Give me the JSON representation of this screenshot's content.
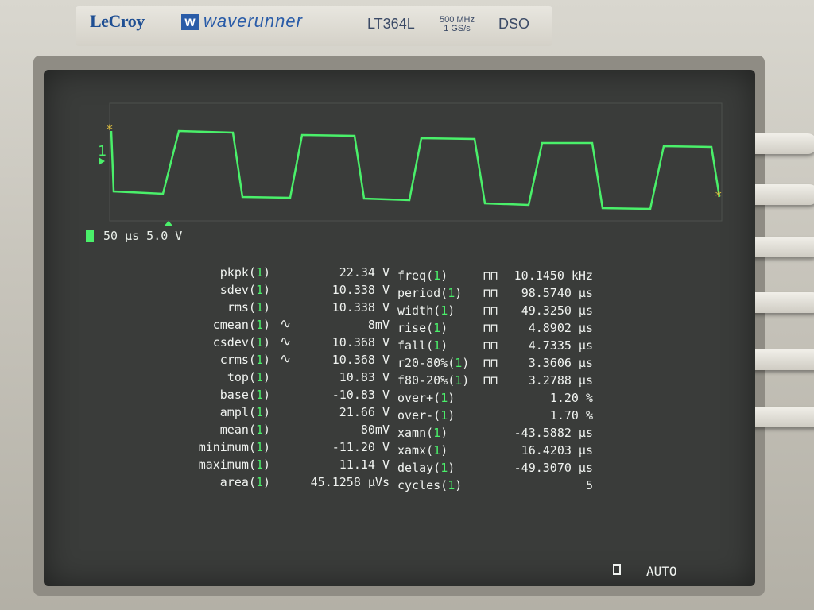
{
  "header": {
    "brand": "LeCroy",
    "logo_letter": "W",
    "product": "waverunner",
    "model": "LT364L",
    "spec_line1": "500 MHz",
    "spec_line2": "1 GS/s",
    "type": "DSO"
  },
  "trace": {
    "channel_label": "1",
    "timebase": "50 µs 5.0 V",
    "color": "#4af06a"
  },
  "measurements_left": [
    {
      "label": "pkpk(1)",
      "value": "22.34 V"
    },
    {
      "label": "sdev(1)",
      "value": "10.338 V"
    },
    {
      "label": "rms(1)",
      "value": "10.338 V"
    },
    {
      "label": "cmean(1)",
      "value": "8mV",
      "cyclic": true
    },
    {
      "label": "csdev(1)",
      "value": "10.368 V",
      "cyclic": true
    },
    {
      "label": "crms(1)",
      "value": "10.368 V",
      "cyclic": true
    },
    {
      "label": "top(1)",
      "value": "10.83 V"
    },
    {
      "label": "base(1)",
      "value": "-10.83 V"
    },
    {
      "label": "ampl(1)",
      "value": "21.66 V"
    },
    {
      "label": "mean(1)",
      "value": "80mV"
    },
    {
      "label": "minimum(1)",
      "value": "-11.20 V"
    },
    {
      "label": "maximum(1)",
      "value": "11.14 V"
    },
    {
      "label": "area(1)",
      "value": "45.1258 µVs"
    }
  ],
  "measurements_right": [
    {
      "label": "freq(1)",
      "value": "10.1450 kHz",
      "pulse": true
    },
    {
      "label": "period(1)",
      "value": "98.5740 µs",
      "pulse": true
    },
    {
      "label": "width(1)",
      "value": "49.3250 µs",
      "pulse": true
    },
    {
      "label": "rise(1)",
      "value": "4.8902 µs",
      "pulse": true
    },
    {
      "label": "fall(1)",
      "value": "4.7335 µs",
      "pulse": true
    },
    {
      "label": "r20-80%(1)",
      "value": "3.3606 µs",
      "pulse": true
    },
    {
      "label": "f80-20%(1)",
      "value": "3.2788 µs",
      "pulse": true
    },
    {
      "label": "over+(1)",
      "value": "1.20 %"
    },
    {
      "label": "over-(1)",
      "value": "1.70 %"
    },
    {
      "label": "xamn(1)",
      "value": "-43.5882 µs"
    },
    {
      "label": "xamx(1)",
      "value": "16.4203 µs"
    },
    {
      "label": "delay(1)",
      "value": "-49.3070 µs"
    },
    {
      "label": "cycles(1)",
      "value": "5"
    }
  ],
  "status": {
    "mode": "AUTO"
  }
}
